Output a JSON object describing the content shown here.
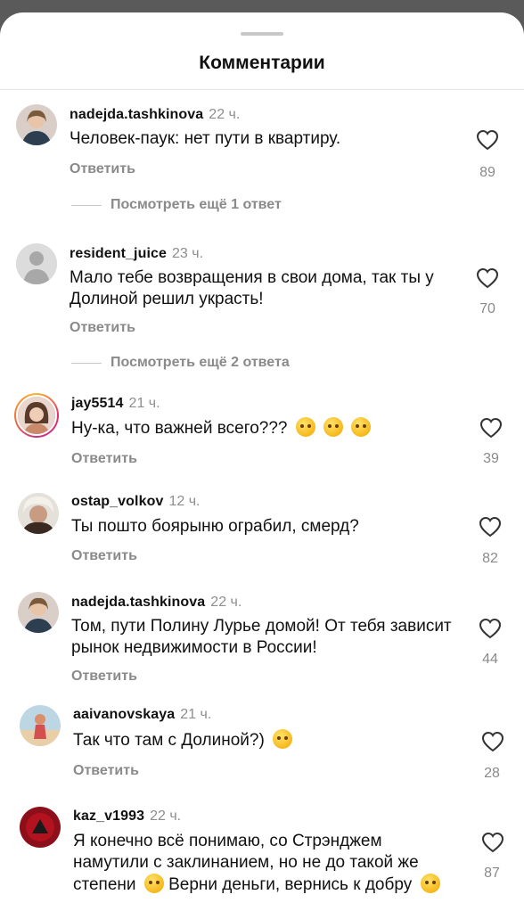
{
  "header": {
    "title": "Комментарии"
  },
  "colors": {
    "accent_story": "#e1306c",
    "muted": "#8a8a8a"
  },
  "comments": [
    {
      "username": "nadejda.tashkinova",
      "time": "22 ч.",
      "text": "Человек-паук: нет пути в квартиру.",
      "reply": "Ответить",
      "likes": "89",
      "more": "Посмотреть ещё 1 ответ",
      "avatar": "photo-woman-icon"
    },
    {
      "username": "resident_juice",
      "time": "23 ч.",
      "text": "Мало тебе возвращения в свои дома,  так ты у Долиной решил украсть!",
      "reply": "Ответить",
      "likes": "70",
      "more": "Посмотреть ещё 2 ответа",
      "avatar": "default-avatar-icon"
    },
    {
      "username": "jay5514",
      "time": "21 ч.",
      "text": "Ну-ка, что важней всего???",
      "reply": "Ответить",
      "likes": "39",
      "avatar": "story-photo-icon",
      "emojis": [
        "monocle-face-emoji",
        "monocle-face-emoji",
        "monocle-face-emoji"
      ]
    },
    {
      "username": "ostap_volkov",
      "time": "12 ч.",
      "text": "Ты пошто боярыню ограбил, смерд?",
      "reply": "Ответить",
      "likes": "82",
      "avatar": "photo-man-icon"
    },
    {
      "username": "nadejda.tashkinova",
      "time": "22 ч.",
      "text": "Том, пути Полину Лурье домой! От тебя зависит рынок недвижимости в России!",
      "reply": "Ответить",
      "likes": "44",
      "avatar": "photo-woman-icon"
    },
    {
      "username": "aaivanovskaya",
      "time": "21 ч.",
      "text": "Так что там с Долиной?)",
      "reply": "Ответить",
      "likes": "28",
      "avatar": "photo-beach-icon",
      "emojis": [
        "face-with-hand-over-mouth-emoji"
      ]
    },
    {
      "username": "kaz_v1993",
      "time": "22 ч.",
      "text": "Я конечно всё понимаю, со Стрэнджем намутили с заклинанием, но не до такой же степени",
      "text2": "Верни деньги, вернись к добру",
      "reply": "",
      "likes": "87",
      "avatar": "photo-red-icon",
      "emojis": [
        "rolling-laughing-emoji",
        "tears-of-joy-emoji"
      ]
    }
  ]
}
